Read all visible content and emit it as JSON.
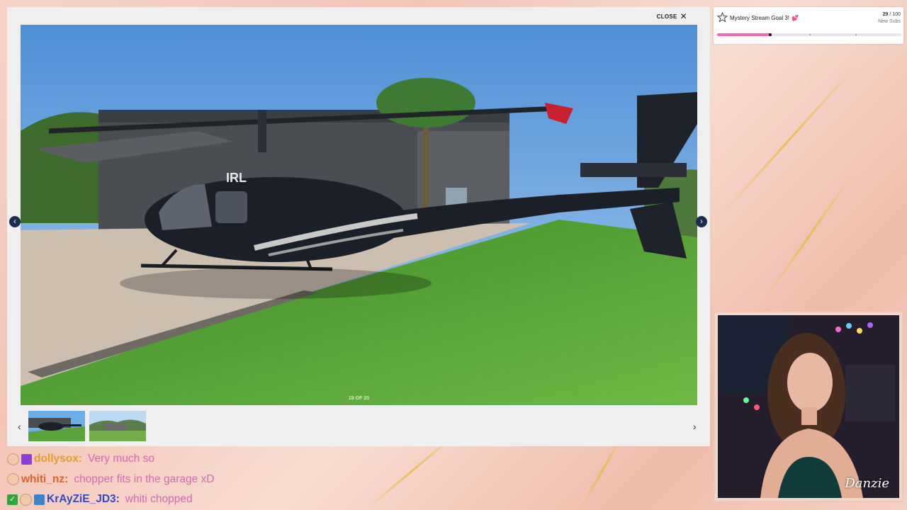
{
  "viewer": {
    "close_label": "CLOSE",
    "counter": "19 OF 20",
    "prev_label": "‹",
    "next_label": "›",
    "photo_tag": "IRL",
    "thumbnails": [
      "helicopter-on-lawn",
      "estate-overview"
    ]
  },
  "goal": {
    "title": "Mystery Stream Goal 3!",
    "heart": "💕",
    "current": "29",
    "target": "100",
    "separator": "/",
    "unit": "New Subs",
    "progress": 0.29
  },
  "stream": {
    "signature": "Danzie"
  },
  "chat": [
    {
      "badges": [
        "sub-badge",
        "purple-diamond-badge"
      ],
      "user": "dollysox",
      "user_color": "#e0a030",
      "message": "Very much so"
    },
    {
      "badges": [
        "sub-badge"
      ],
      "user": "whiti_nz",
      "user_color": "#e0602e",
      "message": "chopper fits in the garage xD"
    },
    {
      "badges": [
        "check-badge",
        "sub-badge",
        "bot-badge"
      ],
      "user": "KrAyZiE_JD3",
      "user_color": "#2f49c8",
      "message": "whiti chopped"
    }
  ],
  "colors": {
    "accent_pink": "#f06bb5",
    "nav_dark": "#1b2d4f",
    "message": "#d26bb0"
  }
}
